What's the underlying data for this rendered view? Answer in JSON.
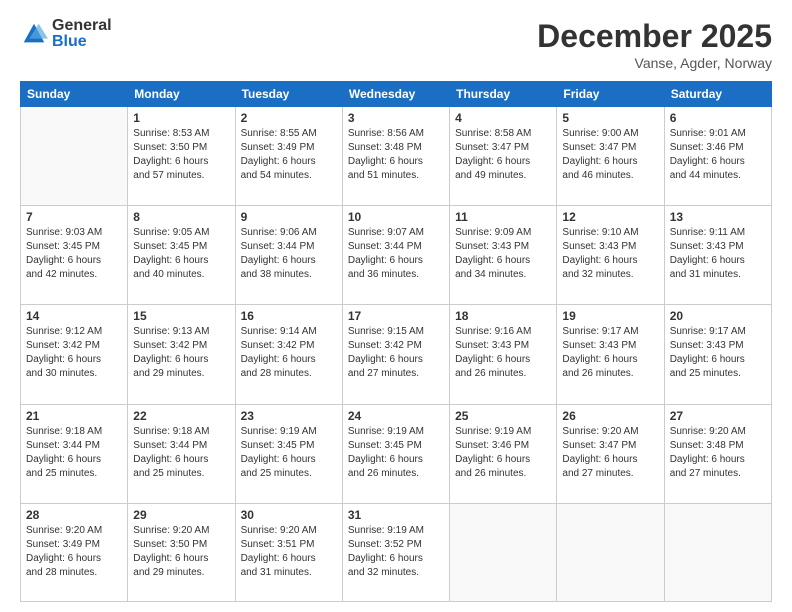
{
  "logo": {
    "general": "General",
    "blue": "Blue"
  },
  "header": {
    "month": "December 2025",
    "location": "Vanse, Agder, Norway"
  },
  "weekdays": [
    "Sunday",
    "Monday",
    "Tuesday",
    "Wednesday",
    "Thursday",
    "Friday",
    "Saturday"
  ],
  "weeks": [
    [
      {
        "day": "",
        "sunrise": "",
        "sunset": "",
        "daylight": ""
      },
      {
        "day": "1",
        "sunrise": "Sunrise: 8:53 AM",
        "sunset": "Sunset: 3:50 PM",
        "daylight": "Daylight: 6 hours and 57 minutes."
      },
      {
        "day": "2",
        "sunrise": "Sunrise: 8:55 AM",
        "sunset": "Sunset: 3:49 PM",
        "daylight": "Daylight: 6 hours and 54 minutes."
      },
      {
        "day": "3",
        "sunrise": "Sunrise: 8:56 AM",
        "sunset": "Sunset: 3:48 PM",
        "daylight": "Daylight: 6 hours and 51 minutes."
      },
      {
        "day": "4",
        "sunrise": "Sunrise: 8:58 AM",
        "sunset": "Sunset: 3:47 PM",
        "daylight": "Daylight: 6 hours and 49 minutes."
      },
      {
        "day": "5",
        "sunrise": "Sunrise: 9:00 AM",
        "sunset": "Sunset: 3:47 PM",
        "daylight": "Daylight: 6 hours and 46 minutes."
      },
      {
        "day": "6",
        "sunrise": "Sunrise: 9:01 AM",
        "sunset": "Sunset: 3:46 PM",
        "daylight": "Daylight: 6 hours and 44 minutes."
      }
    ],
    [
      {
        "day": "7",
        "sunrise": "Sunrise: 9:03 AM",
        "sunset": "Sunset: 3:45 PM",
        "daylight": "Daylight: 6 hours and 42 minutes."
      },
      {
        "day": "8",
        "sunrise": "Sunrise: 9:05 AM",
        "sunset": "Sunset: 3:45 PM",
        "daylight": "Daylight: 6 hours and 40 minutes."
      },
      {
        "day": "9",
        "sunrise": "Sunrise: 9:06 AM",
        "sunset": "Sunset: 3:44 PM",
        "daylight": "Daylight: 6 hours and 38 minutes."
      },
      {
        "day": "10",
        "sunrise": "Sunrise: 9:07 AM",
        "sunset": "Sunset: 3:44 PM",
        "daylight": "Daylight: 6 hours and 36 minutes."
      },
      {
        "day": "11",
        "sunrise": "Sunrise: 9:09 AM",
        "sunset": "Sunset: 3:43 PM",
        "daylight": "Daylight: 6 hours and 34 minutes."
      },
      {
        "day": "12",
        "sunrise": "Sunrise: 9:10 AM",
        "sunset": "Sunset: 3:43 PM",
        "daylight": "Daylight: 6 hours and 32 minutes."
      },
      {
        "day": "13",
        "sunrise": "Sunrise: 9:11 AM",
        "sunset": "Sunset: 3:43 PM",
        "daylight": "Daylight: 6 hours and 31 minutes."
      }
    ],
    [
      {
        "day": "14",
        "sunrise": "Sunrise: 9:12 AM",
        "sunset": "Sunset: 3:42 PM",
        "daylight": "Daylight: 6 hours and 30 minutes."
      },
      {
        "day": "15",
        "sunrise": "Sunrise: 9:13 AM",
        "sunset": "Sunset: 3:42 PM",
        "daylight": "Daylight: 6 hours and 29 minutes."
      },
      {
        "day": "16",
        "sunrise": "Sunrise: 9:14 AM",
        "sunset": "Sunset: 3:42 PM",
        "daylight": "Daylight: 6 hours and 28 minutes."
      },
      {
        "day": "17",
        "sunrise": "Sunrise: 9:15 AM",
        "sunset": "Sunset: 3:42 PM",
        "daylight": "Daylight: 6 hours and 27 minutes."
      },
      {
        "day": "18",
        "sunrise": "Sunrise: 9:16 AM",
        "sunset": "Sunset: 3:43 PM",
        "daylight": "Daylight: 6 hours and 26 minutes."
      },
      {
        "day": "19",
        "sunrise": "Sunrise: 9:17 AM",
        "sunset": "Sunset: 3:43 PM",
        "daylight": "Daylight: 6 hours and 26 minutes."
      },
      {
        "day": "20",
        "sunrise": "Sunrise: 9:17 AM",
        "sunset": "Sunset: 3:43 PM",
        "daylight": "Daylight: 6 hours and 25 minutes."
      }
    ],
    [
      {
        "day": "21",
        "sunrise": "Sunrise: 9:18 AM",
        "sunset": "Sunset: 3:44 PM",
        "daylight": "Daylight: 6 hours and 25 minutes."
      },
      {
        "day": "22",
        "sunrise": "Sunrise: 9:18 AM",
        "sunset": "Sunset: 3:44 PM",
        "daylight": "Daylight: 6 hours and 25 minutes."
      },
      {
        "day": "23",
        "sunrise": "Sunrise: 9:19 AM",
        "sunset": "Sunset: 3:45 PM",
        "daylight": "Daylight: 6 hours and 25 minutes."
      },
      {
        "day": "24",
        "sunrise": "Sunrise: 9:19 AM",
        "sunset": "Sunset: 3:45 PM",
        "daylight": "Daylight: 6 hours and 26 minutes."
      },
      {
        "day": "25",
        "sunrise": "Sunrise: 9:19 AM",
        "sunset": "Sunset: 3:46 PM",
        "daylight": "Daylight: 6 hours and 26 minutes."
      },
      {
        "day": "26",
        "sunrise": "Sunrise: 9:20 AM",
        "sunset": "Sunset: 3:47 PM",
        "daylight": "Daylight: 6 hours and 27 minutes."
      },
      {
        "day": "27",
        "sunrise": "Sunrise: 9:20 AM",
        "sunset": "Sunset: 3:48 PM",
        "daylight": "Daylight: 6 hours and 27 minutes."
      }
    ],
    [
      {
        "day": "28",
        "sunrise": "Sunrise: 9:20 AM",
        "sunset": "Sunset: 3:49 PM",
        "daylight": "Daylight: 6 hours and 28 minutes."
      },
      {
        "day": "29",
        "sunrise": "Sunrise: 9:20 AM",
        "sunset": "Sunset: 3:50 PM",
        "daylight": "Daylight: 6 hours and 29 minutes."
      },
      {
        "day": "30",
        "sunrise": "Sunrise: 9:20 AM",
        "sunset": "Sunset: 3:51 PM",
        "daylight": "Daylight: 6 hours and 31 minutes."
      },
      {
        "day": "31",
        "sunrise": "Sunrise: 9:19 AM",
        "sunset": "Sunset: 3:52 PM",
        "daylight": "Daylight: 6 hours and 32 minutes."
      },
      {
        "day": "",
        "sunrise": "",
        "sunset": "",
        "daylight": ""
      },
      {
        "day": "",
        "sunrise": "",
        "sunset": "",
        "daylight": ""
      },
      {
        "day": "",
        "sunrise": "",
        "sunset": "",
        "daylight": ""
      }
    ]
  ]
}
